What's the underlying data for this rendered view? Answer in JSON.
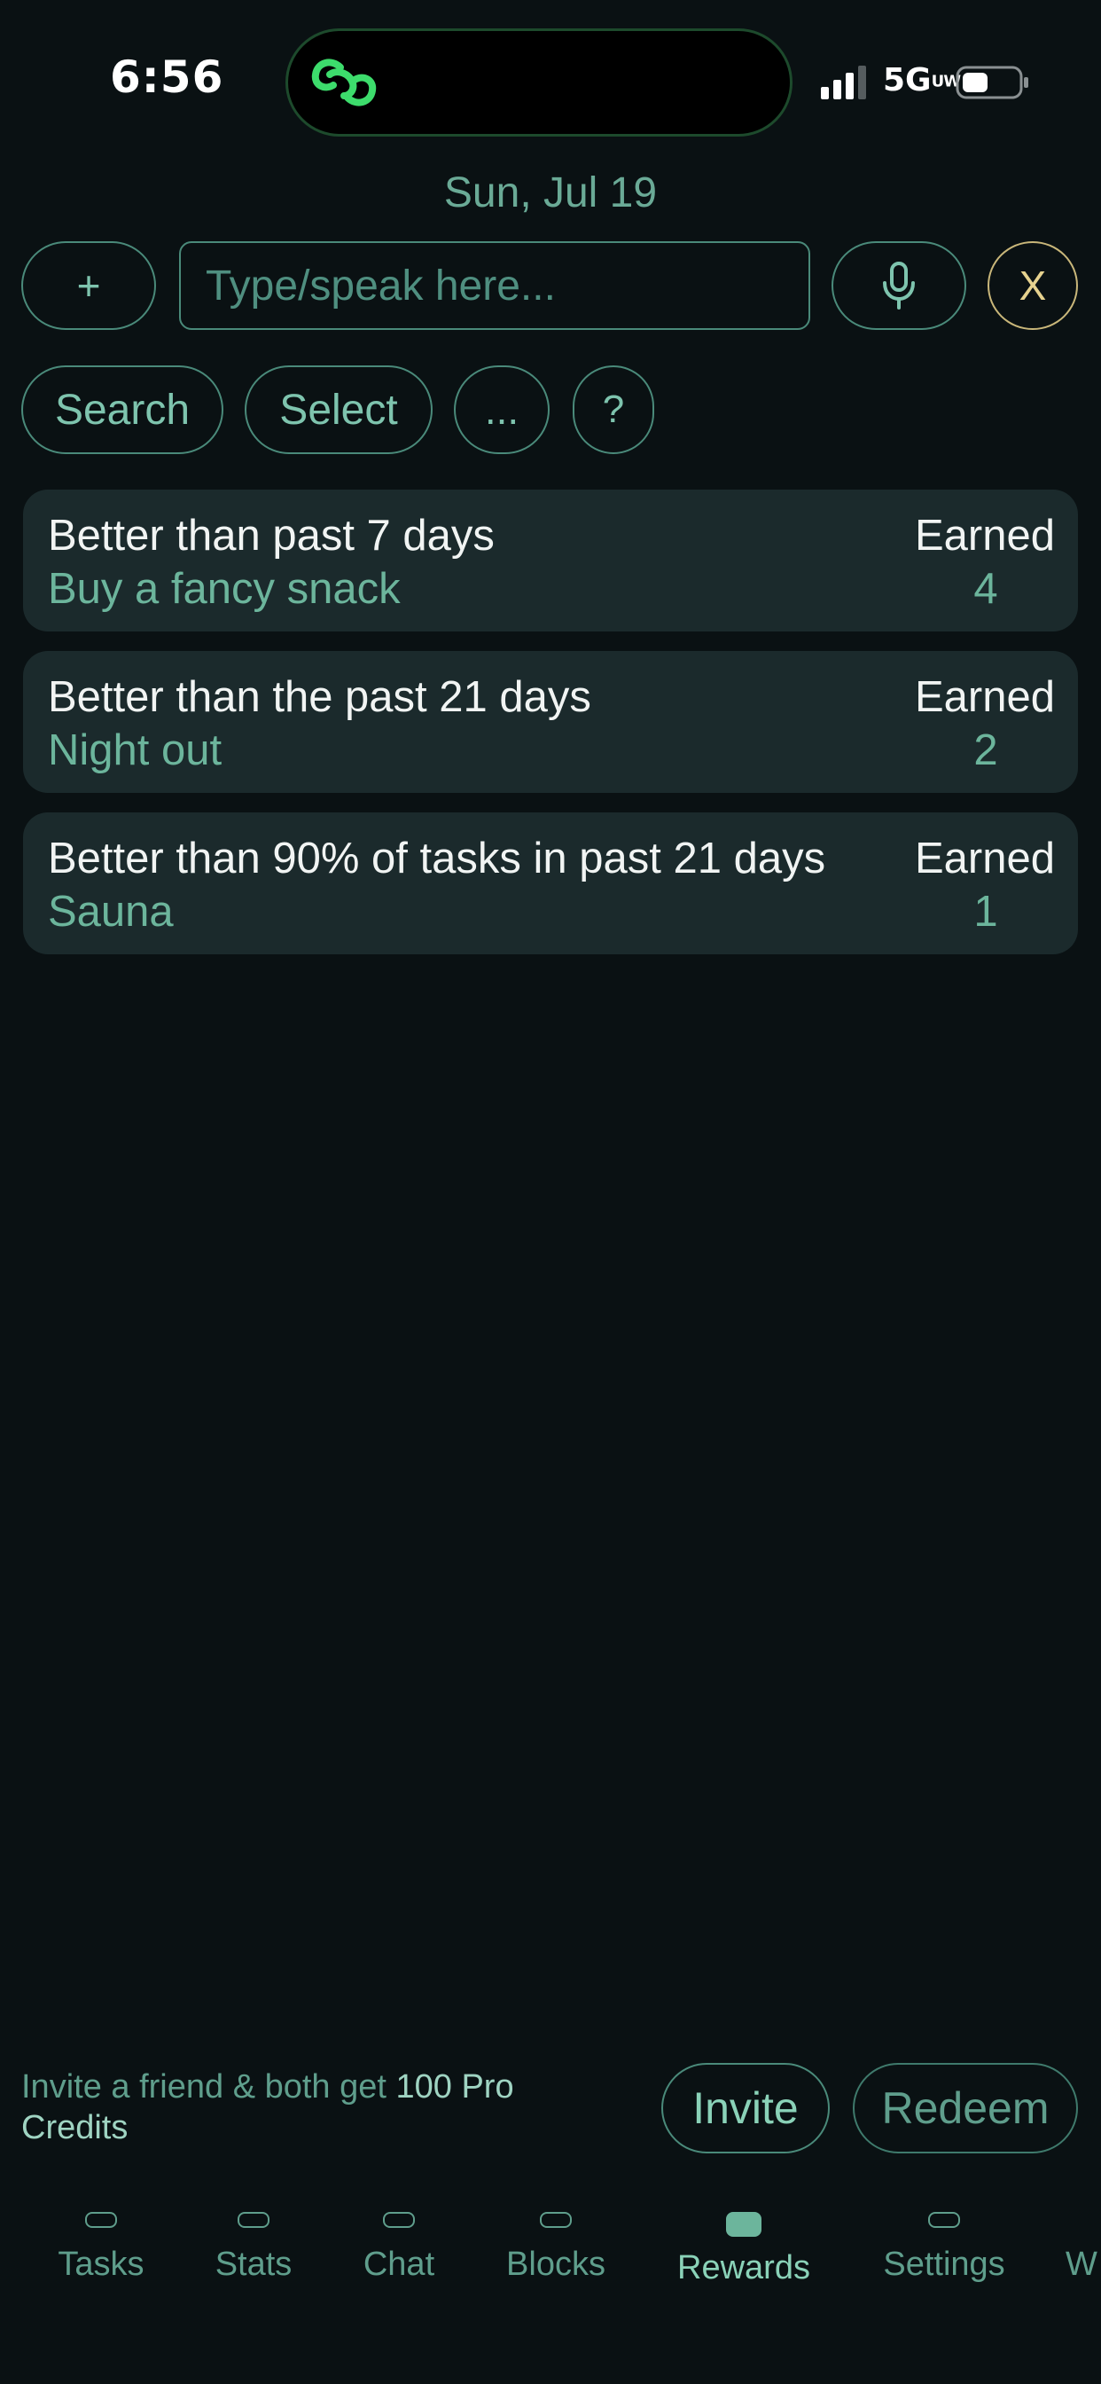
{
  "status_bar": {
    "time": "6:56",
    "network": "5G",
    "network_suffix": "UW"
  },
  "header": {
    "date": "Sun, Jul 19"
  },
  "toolbar": {
    "add_label": "+",
    "input_placeholder": "Type/speak here...",
    "close_label": "X",
    "search_label": "Search",
    "select_label": "Select",
    "more_label": "...",
    "help_label": "?"
  },
  "rewards": [
    {
      "condition": "Better than past 7 days",
      "reward": "Buy a fancy snack",
      "earned_label": "Earned",
      "earned": "4"
    },
    {
      "condition": "Better than the past 21 days",
      "reward": "Night out",
      "earned_label": "Earned",
      "earned": "2"
    },
    {
      "condition": "Better than 90% of tasks in past 21 days",
      "reward": "Sauna",
      "earned_label": "Earned",
      "earned": "1"
    }
  ],
  "invite": {
    "text_prefix": "Invite a friend & both get ",
    "text_bold": "100 Pro",
    "text_suffix": "Credits",
    "invite_label": "Invite",
    "redeem_label": "Redeem"
  },
  "nav": {
    "items": [
      {
        "label": "Tasks"
      },
      {
        "label": "Stats"
      },
      {
        "label": "Chat"
      },
      {
        "label": "Blocks"
      },
      {
        "label": "Rewards"
      },
      {
        "label": "Settings"
      },
      {
        "label": "W"
      }
    ],
    "active": "Rewards"
  },
  "colors": {
    "background": "#0a1113",
    "accent": "#6cb59c",
    "card": "#1b2a2c",
    "close_accent": "#e6d28f"
  }
}
